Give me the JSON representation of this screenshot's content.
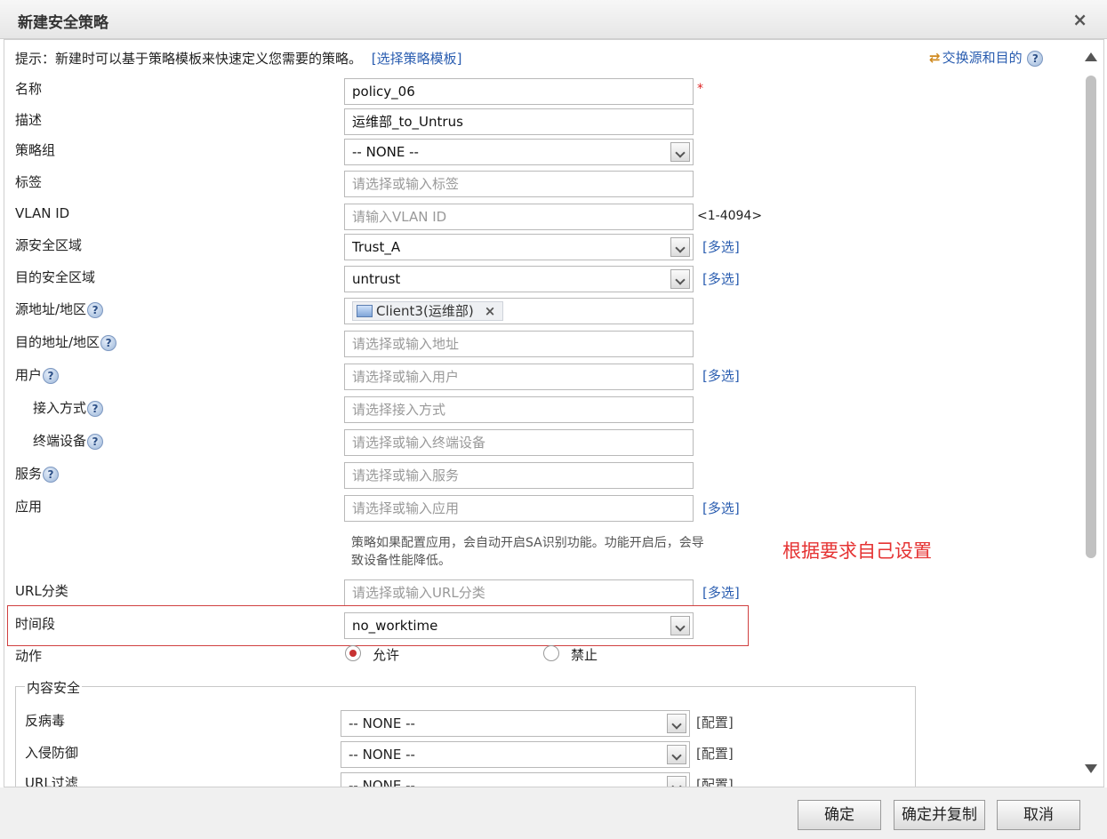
{
  "dialog": {
    "title": "新建安全策略",
    "close": "×"
  },
  "hint": {
    "text": "提示：新建时可以基于策略模板来快速定义您需要的策略。",
    "link": "[选择策略模板]",
    "swap": "交换源和目的"
  },
  "form": {
    "name": {
      "label": "名称",
      "value": "policy_06",
      "required": "*"
    },
    "desc": {
      "label": "描述",
      "value": "运维部_to_Untrus"
    },
    "group": {
      "label": "策略组",
      "value": "-- NONE --"
    },
    "tag": {
      "label": "标签",
      "placeholder": "请选择或输入标签"
    },
    "vlan": {
      "label": "VLAN ID",
      "placeholder": "请输入VLAN ID",
      "hint": "<1-4094>"
    },
    "src_zone": {
      "label": "源安全区域",
      "value": "Trust_A",
      "multi": "[多选]"
    },
    "dst_zone": {
      "label": "目的安全区域",
      "value": "untrust",
      "multi": "[多选]"
    },
    "src_addr": {
      "label": "源地址/地区",
      "chip": "Client3(运维部)"
    },
    "dst_addr": {
      "label": "目的地址/地区",
      "placeholder": "请选择或输入地址"
    },
    "user": {
      "label": "用户",
      "placeholder": "请选择或输入用户",
      "multi": "[多选]"
    },
    "access": {
      "label": "接入方式",
      "placeholder": "请选择接入方式"
    },
    "terminal": {
      "label": "终端设备",
      "placeholder": "请选择或输入终端设备"
    },
    "service": {
      "label": "服务",
      "placeholder": "请选择或输入服务"
    },
    "app": {
      "label": "应用",
      "placeholder": "请选择或输入应用",
      "multi": "[多选]",
      "note": "策略如果配置应用，会自动开启SA识别功能。功能开启后，会导致设备性能降低。"
    },
    "url": {
      "label": "URL分类",
      "placeholder": "请选择或输入URL分类",
      "multi": "[多选]"
    },
    "time": {
      "label": "时间段",
      "value": "no_worktime"
    },
    "action": {
      "label": "动作",
      "allow": "允许",
      "deny": "禁止",
      "selected": "允许"
    },
    "annotation": "根据要求自己设置"
  },
  "content_security": {
    "legend": "内容安全",
    "rows": [
      {
        "label": "反病毒",
        "value": "-- NONE --",
        "config": "[配置]"
      },
      {
        "label": "入侵防御",
        "value": "-- NONE --",
        "config": "[配置]"
      },
      {
        "label": "URL过滤",
        "value": "-- NONE --",
        "config": "[配置]"
      }
    ]
  },
  "help_glyph": "?",
  "footer": {
    "ok": "确定",
    "ok_copy": "确定并复制",
    "cancel": "取消"
  }
}
